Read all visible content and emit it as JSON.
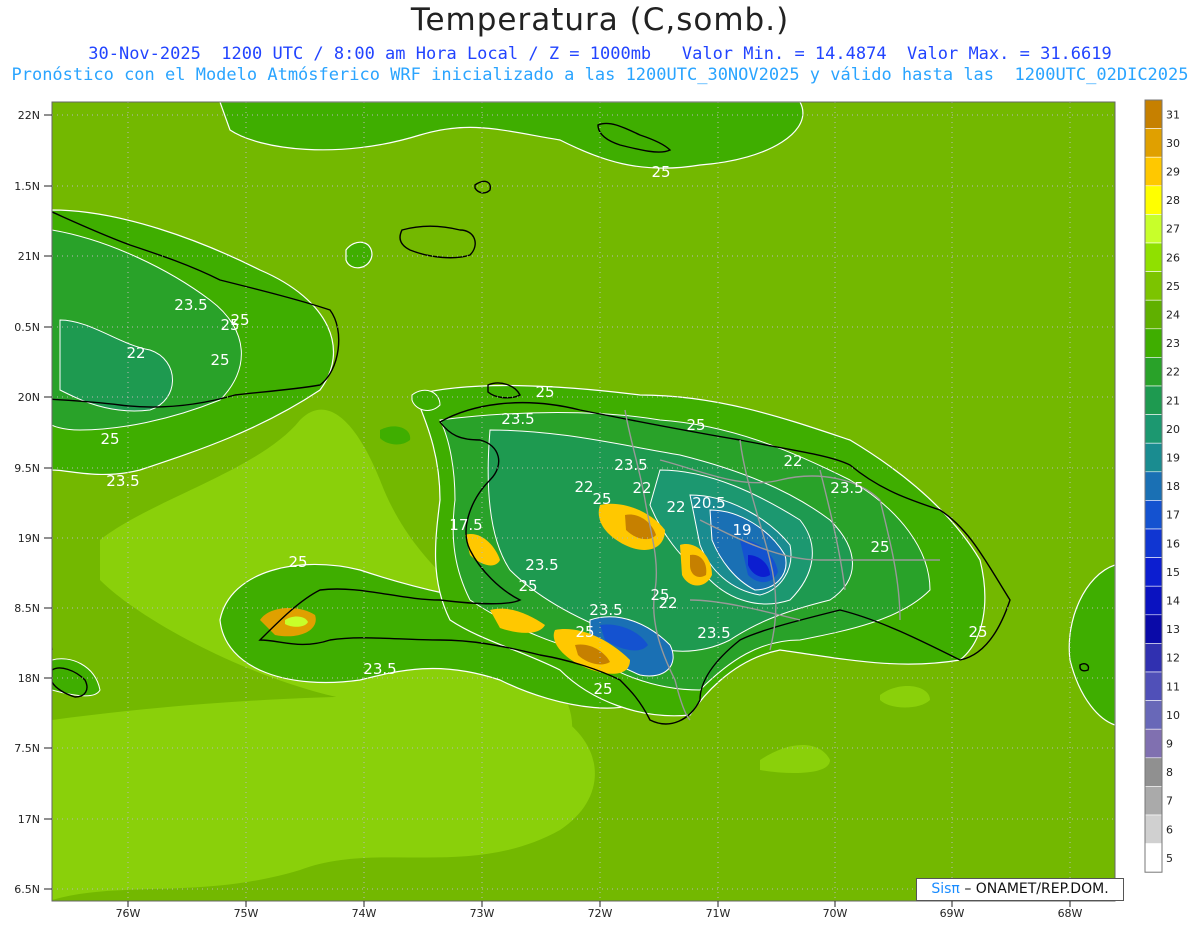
{
  "title": "Temperatura (C,somb.)",
  "subtitle_line1": "30-Nov-2025  1200 UTC / 8:00 am Hora Local / Z = 1000mb   Valor Min. = 14.4874  Valor Max. = 31.6619",
  "subtitle_line2": "Pronóstico con el Modelo Atmósferico WRF inicializado a las 1200UTC_30NOV2025 y válido hasta las  1200UTC_02DIC2025",
  "credit": {
    "brand": "Sisπ",
    "org": "– ONAMET/REP.DOM."
  },
  "lat_labels": [
    "22N",
    "1.5N",
    "21N",
    "0.5N",
    "20N",
    "9.5N",
    "19N",
    "8.5N",
    "18N",
    "7.5N",
    "17N",
    "6.5N"
  ],
  "lon_labels": [
    "76W",
    "75W",
    "74W",
    "73W",
    "72W",
    "71W",
    "70W",
    "69W",
    "68W"
  ],
  "contour_labels": [
    "25",
    "23.5",
    "25",
    "25",
    "22",
    "25",
    "23.5",
    "25",
    "25",
    "23.5",
    "23.5",
    "22",
    "22",
    "22",
    "23.5",
    "25",
    "22",
    "20.5",
    "19",
    "17.5",
    "25",
    "23.5",
    "25",
    "25",
    "23.5",
    "23.5",
    "22",
    "25",
    "23.5",
    "25",
    "25",
    "25",
    "25"
  ],
  "colorbar": {
    "labels": [
      "31",
      "30",
      "29",
      "28",
      "27",
      "26",
      "25",
      "24",
      "23",
      "22",
      "21",
      "20",
      "19",
      "18",
      "17",
      "16",
      "15",
      "14",
      "13",
      "12",
      "11",
      "10",
      "9",
      "8",
      "7",
      "6",
      "5"
    ],
    "colors": [
      "#c68000",
      "#e0a000",
      "#ffc800",
      "#ffff00",
      "#c8ff2a",
      "#90e000",
      "#7cc400",
      "#60b000",
      "#3fae00",
      "#29a229",
      "#1e9a50",
      "#1c9870",
      "#1a8c90",
      "#1a70b4",
      "#1452d0",
      "#1036d2",
      "#0c1ed0",
      "#0a12c0",
      "#0a0aa8",
      "#3030b0",
      "#5050b8",
      "#6868b8",
      "#8070b0",
      "#909090",
      "#aaaaaa",
      "#d0d0d0",
      "#ffffff"
    ]
  },
  "colors": {
    "sea": "#7ec410",
    "sea_light": "#8fd40c",
    "coast": "#000000",
    "border": "#9a9a9a",
    "contour": "#ffffff"
  }
}
